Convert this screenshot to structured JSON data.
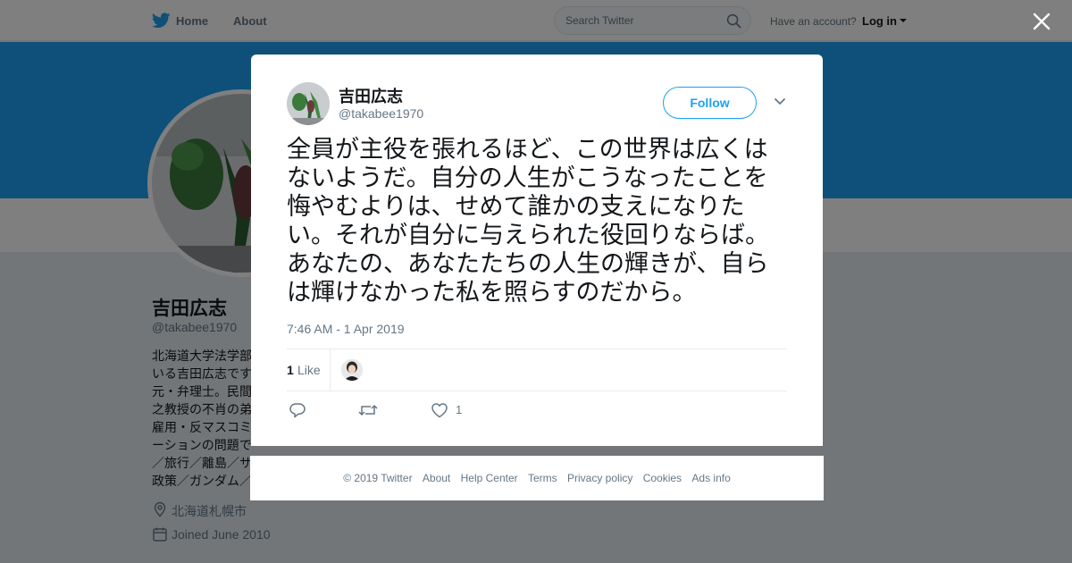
{
  "nav": {
    "home": "Home",
    "about": "About",
    "search_placeholder": "Search Twitter",
    "have_account": "Have an account?",
    "login": "Log in"
  },
  "profile": {
    "name": "吉田広志",
    "handle": "@takabee1970",
    "bio": "北海道大学法学部\nいる吉田広志です\n元・弁理士。民間\n之教授の不肖の弟\n雇用・反マスコミ\nーションの問題で\n／旅行／離島／サ\n政策／ガンダム／",
    "location": "北海道札幌市",
    "joined": "Joined June 2010"
  },
  "tweet": {
    "name": "吉田広志",
    "handle": "@takabee1970",
    "follow_label": "Follow",
    "text": "全員が主役を張れるほど、この世界は広くはないようだ。自分の人生がこうなったことを悔やむよりは、せめて誰かの支えになりたい。それが自分に与えられた役回りならば。あなたの、あなたたちの人生の輝きが、自らは輝けなかった私を照らすのだから。",
    "timestamp": "7:46 AM - 1 Apr 2019",
    "likes_count": "1",
    "likes_label": "Like",
    "action_like_count": "1"
  },
  "footer": {
    "copyright": "© 2019 Twitter",
    "links": [
      "About",
      "Help Center",
      "Terms",
      "Privacy policy",
      "Cookies",
      "Ads info"
    ]
  },
  "colors": {
    "brand": "#1da1f2",
    "banner": "#1da1f2",
    "overlay": "rgba(0,0,0,0.5)"
  },
  "icons": {
    "logo": "twitter-bird-icon",
    "search": "search-icon",
    "close": "close-icon",
    "more": "chevron-down-icon",
    "reply": "reply-icon",
    "retweet": "retweet-icon",
    "like": "heart-icon",
    "location": "location-pin-icon",
    "calendar": "calendar-icon"
  }
}
